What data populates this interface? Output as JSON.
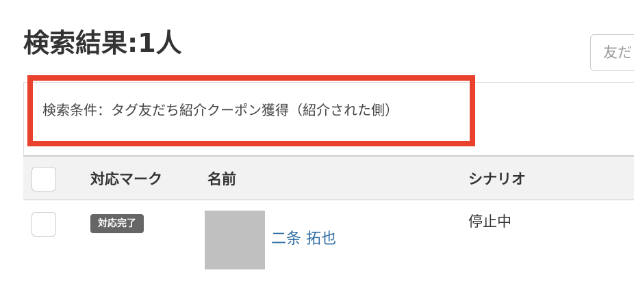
{
  "header": {
    "title": "検索結果:1人",
    "friend_search_placeholder": "友だ"
  },
  "search_condition": {
    "text": "検索条件：タグ友だち紹介クーポン獲得（紹介された側）",
    "highlight_color": "#e8412d"
  },
  "table": {
    "columns": [
      "対応マーク",
      "名前",
      "シナリオ"
    ],
    "rows": [
      {
        "badge": "対応完了",
        "name": "二条 拓也",
        "scenario": "停止中",
        "checked": false
      }
    ]
  },
  "colors": {
    "link": "#2e6da4",
    "badge_bg": "#666666",
    "header_bg": "#f2f2f2",
    "avatar_placeholder": "#c0c0c0"
  }
}
